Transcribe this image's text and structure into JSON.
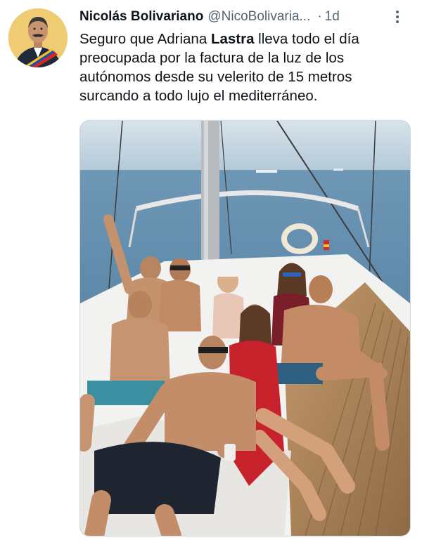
{
  "tweet": {
    "display_name": "Nicolás Bolivariano",
    "handle": "@NicoBolivaria...",
    "separator": "·",
    "time": "1d",
    "text_before": "Seguro que Adriana ",
    "text_bold": "Lastra",
    "text_after": " lleva todo el día preocupada por la factura de la luz de los autónomos desde su velerito de 15 metros surcando a todo lujo el mediterráneo."
  },
  "colors": {
    "secondary_text": "#536471",
    "primary_text": "#0f1419"
  },
  "icons": {
    "more": "more-vertical-icon"
  }
}
